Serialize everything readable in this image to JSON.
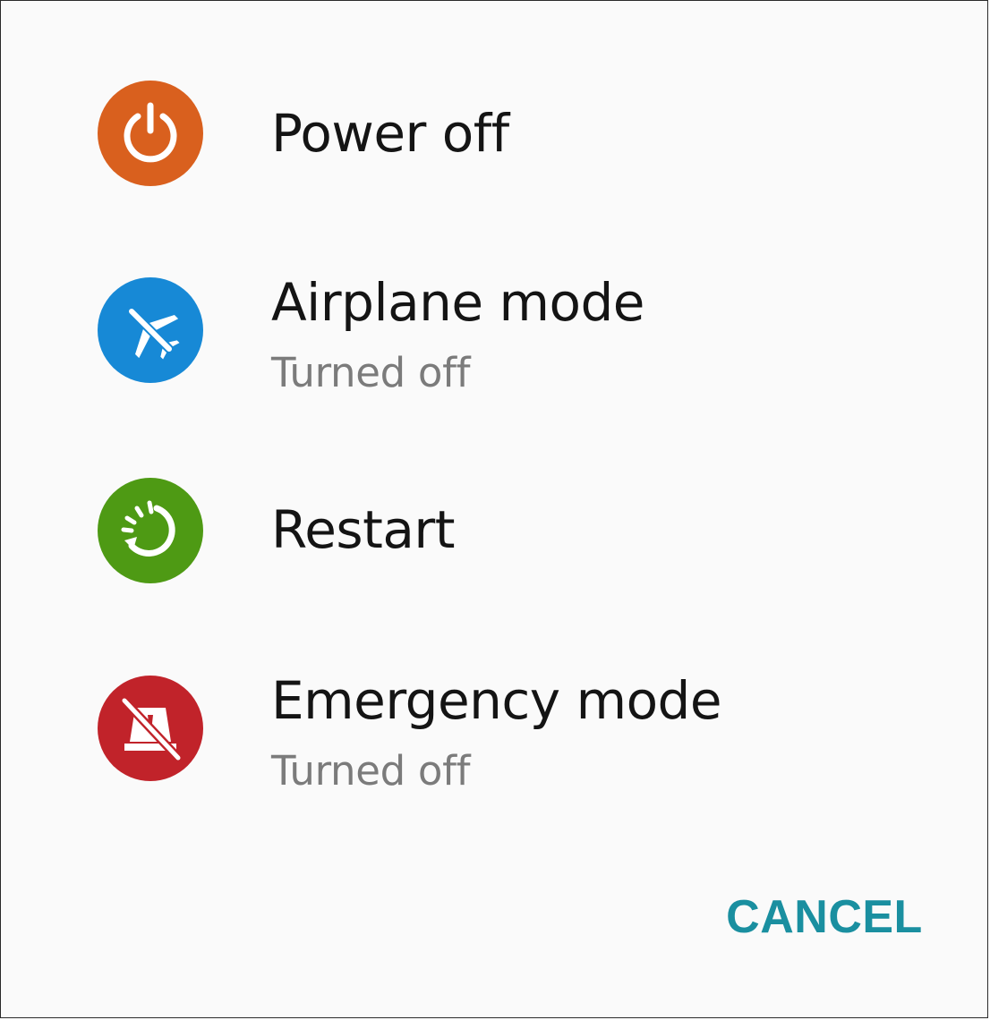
{
  "dialog": {
    "options": [
      {
        "label": "Power off",
        "subtitle": "",
        "icon": "power-icon",
        "color": "#d9601e"
      },
      {
        "label": "Airplane mode",
        "subtitle": "Turned off",
        "icon": "airplane-off-icon",
        "color": "#1789d6"
      },
      {
        "label": "Restart",
        "subtitle": "",
        "icon": "restart-icon",
        "color": "#4e9a14"
      },
      {
        "label": "Emergency mode",
        "subtitle": "Turned off",
        "icon": "emergency-off-icon",
        "color": "#c1232a"
      }
    ],
    "cancel_label": "CANCEL",
    "accent_color": "#1a8fa0"
  }
}
